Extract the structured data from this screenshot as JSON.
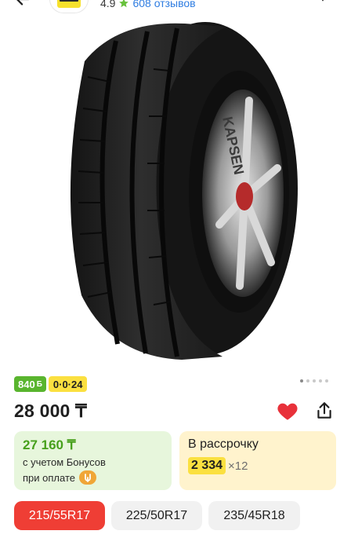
{
  "header": {
    "rating": "4.9",
    "reviews": "608 отзывов"
  },
  "product": {
    "image_alt_icon": "tire-photo",
    "sidewall_brand": "KAPSEN",
    "gallery_dots": 5,
    "gallery_active_index": 0
  },
  "badges": {
    "bonus_value": "840",
    "bonus_symbol": "Б",
    "installment": "0·0·24"
  },
  "price": {
    "main": "28 000 ₸"
  },
  "bonus_card": {
    "amount": "27 160 ₸",
    "line1": "с учетом Бонусов",
    "line2": "при оплате"
  },
  "installment_card": {
    "title": "В рассрочку",
    "monthly": "2 334",
    "months": "×12"
  },
  "sizes": [
    {
      "label": "215/55R17",
      "selected": true
    },
    {
      "label": "225/50R17",
      "selected": false
    },
    {
      "label": "235/45R18",
      "selected": false
    }
  ],
  "colors": {
    "accent_red": "#ef3e35",
    "bonus_green": "#59b52e",
    "installment_yellow": "#fbe040",
    "link_blue": "#2f7de1",
    "heart_red": "#e8313a"
  }
}
